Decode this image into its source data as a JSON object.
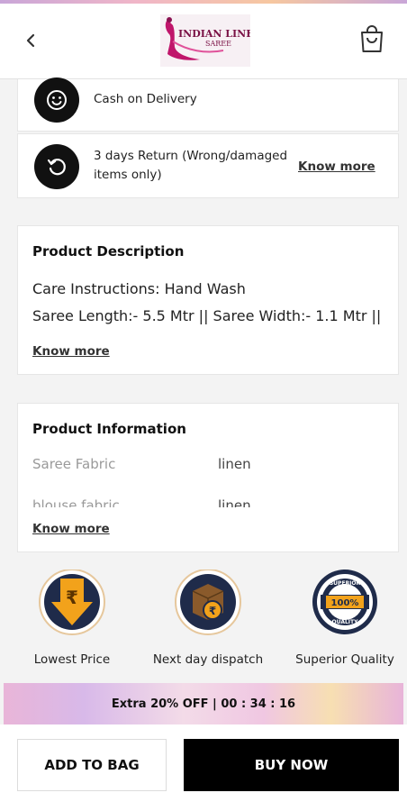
{
  "header": {
    "logo_line1": "INDIAN LINEN",
    "logo_line2": "SAREE"
  },
  "services": [
    {
      "label": "Cash on Delivery"
    },
    {
      "label_line1": "3 days Return (Wrong/damaged",
      "label_line2": "items only)",
      "link": "Know more"
    }
  ],
  "description": {
    "title": "Product Description",
    "lines": [
      "Care Instructions: Hand Wash",
      "Saree Length:- 5.5 Mtr || Saree Width:- 1.1 Mtr ||"
    ],
    "link": "Know more"
  },
  "information": {
    "title": "Product Information",
    "rows": [
      {
        "key": "Saree Fabric",
        "value": "linen"
      },
      {
        "key": "blouse fabric",
        "value": "linen"
      }
    ],
    "link": "Know more"
  },
  "badges": [
    {
      "label": "Lowest Price",
      "icon_text": "₹"
    },
    {
      "label": "Next day dispatch",
      "icon_text": "₹"
    },
    {
      "label": "Superior Quality",
      "icon_text": "100%",
      "ring_top": "SUPERIOR",
      "ring_bottom": "QUALITY"
    }
  ],
  "offer": {
    "text": "Extra 20% OFF | 00 : 34 : 16"
  },
  "actions": {
    "add_to_bag": "ADD TO BAG",
    "buy_now": "BUY NOW"
  },
  "colors": {
    "gold": "#f2a21b",
    "navy": "#1f2b4a",
    "black": "#000000"
  }
}
